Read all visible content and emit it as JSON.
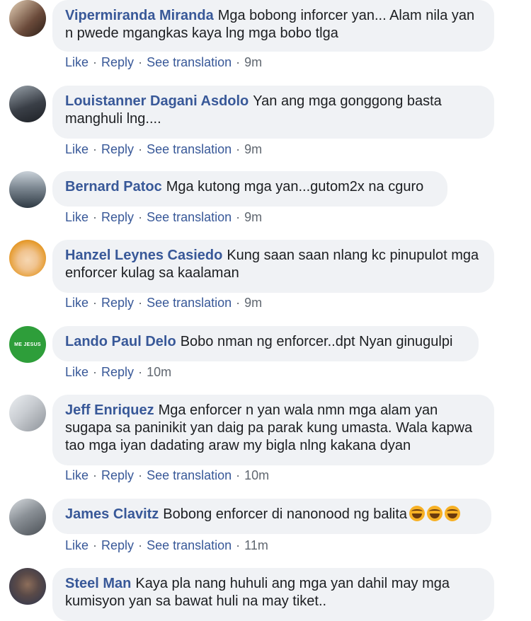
{
  "actions": {
    "like": "Like",
    "reply": "Reply",
    "see_translation": "See translation",
    "separator": "·"
  },
  "comments": [
    {
      "name": "Vipermiranda Miranda",
      "text": "Mga bobong inforcer yan... Alam nila yan n pwede mgangkas kaya lng mga bobo tlga",
      "time": "9m",
      "avatar_colors": [
        "#6a4a3a",
        "#e7d3b8"
      ]
    },
    {
      "name": "Louistanner Dagani Asdolo",
      "text": "Yan ang mga gonggong basta manghuli lng....",
      "time": "9m",
      "avatar_colors": [
        "#3a3f47",
        "#9aa3ab"
      ]
    },
    {
      "name": "Bernard Patoc",
      "text": "Mga kutong mga yan...gutom2x na cguro",
      "time": "9m",
      "avatar_colors": [
        "#2f3a44",
        "#c9d1d8"
      ]
    },
    {
      "name": "Hanzel Leynes Casiedo",
      "text": "Kung saan saan nlang kc pinupulot mga enforcer kulag sa kaalaman",
      "time": "9m",
      "avatar_colors": [
        "#e59a2c",
        "#f6d7b2"
      ]
    },
    {
      "name": "Lando Paul Delo",
      "text": "Bobo nman ng enforcer..dpt Nyan ginugulpi",
      "time": "10m",
      "avatar_colors": [
        "#2e9e3a",
        "#1f7a2a"
      ],
      "avatar_text": "ME JESUS"
    },
    {
      "name": "Jeff Enriquez",
      "text": "Mga enforcer n yan wala nmn mga alam yan sugapa sa paninikit yan daig pa parak kung umasta. Wala kapwa tao mga iyan dadating araw my bigla nlng kakana dyan",
      "time": "10m",
      "avatar_colors": [
        "#c8ccd1",
        "#8e9399"
      ]
    },
    {
      "name": "James Clavitz",
      "text": "Bobong enforcer di nanonood ng balita",
      "time": "11m",
      "avatar_colors": [
        "#4a4f55",
        "#d9dde1"
      ]
    },
    {
      "name": "Steel Man",
      "text": "Kaya pla nang huhuli ang mga yan dahil may mga kumisyon yan sa bawat huli na may tiket..",
      "time": "",
      "avatar_colors": [
        "#2b3550",
        "#8d6e5a"
      ]
    }
  ],
  "colors": {
    "name": "#385898",
    "bubble": "#f0f2f5",
    "meta": "#606770"
  }
}
